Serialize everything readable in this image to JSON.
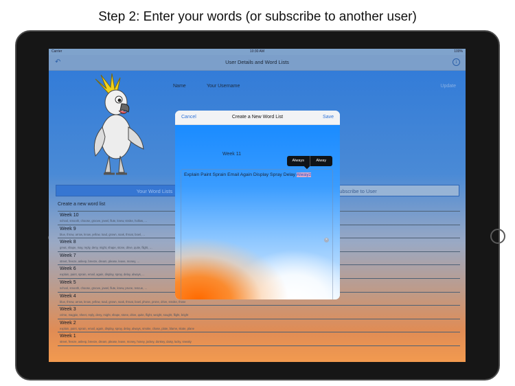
{
  "caption": "Step 2: Enter your words (or subscribe to another user)",
  "status_bar": {
    "carrier": "Carrier",
    "time": "10:30 AM",
    "battery": "100%"
  },
  "nav": {
    "title": "User Details and Word Lists",
    "info_icon": "info-circle-icon",
    "back_icon": "back-arrow-icon"
  },
  "user": {
    "name_label": "Name",
    "name_value": "Your Username",
    "update_label": "Update"
  },
  "segments": {
    "left": "Your Word Lists",
    "right": "Subscribe to User"
  },
  "list": {
    "create_label": "Create a new word list",
    "items": [
      {
        "title": "Week 10",
        "words": "school, smooth, choose, groove, jewel, flute, knew, stroke, hollow, …"
      },
      {
        "title": "Week 9",
        "words": "blue, throw, arrow, know, yellow, toad, grown, soak, throat, bowl, …"
      },
      {
        "title": "Week 8",
        "words": "great, shape, may, reply, deny, might, shape, stone, drive, quite, flight, …"
      },
      {
        "title": "Week 7",
        "words": "street, freeze, asleep, breeze, dream, please, leave, money, …"
      },
      {
        "title": "Week 6",
        "words": "explain, paint, sprain, email, again, display, spray, delay, always, ..."
      },
      {
        "title": "Week 5",
        "words": "school, smooth, choose, groove, jewel, flute, knew, prune, rescue, …"
      },
      {
        "title": "Week 4",
        "words": "blue, throw, arrow, know, yellow, toad, grown, soak, throat, bowl, phone, prone, drive, smoke, those"
      },
      {
        "title": "Week 3",
        "words": "crime, magpie, sheet, reply, deny, might, shape, stone, drive, quite, flight, weight, sought, flight, bright"
      },
      {
        "title": "Week 2",
        "words": "explain, paint, sprain, email, again, display, spray, delay, always, smoke, chase, plate, blame, skate, plane"
      },
      {
        "title": "Week 1",
        "words": "street, freeze, asleep, breeze, dream, please, leave, money, honey, jockey, donkey, daisy, lucky, sneaky"
      }
    ]
  },
  "modal": {
    "cancel_label": "Cancel",
    "title": "Create a New Word List",
    "save_label": "Save",
    "list_name": "Week 11",
    "words_text": "Explain Paint Sprain Email Again Display Spray Delay ",
    "misspelled_word": "Alwayz",
    "autocorrect": [
      "Always",
      "Alway"
    ]
  }
}
